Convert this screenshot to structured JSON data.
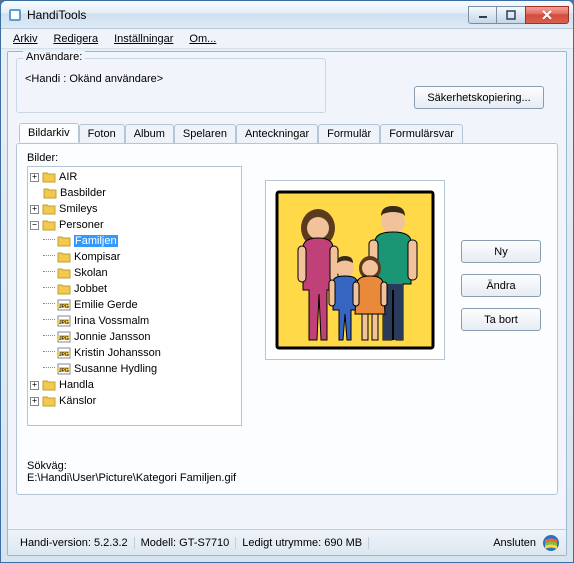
{
  "window": {
    "title": "HandiTools"
  },
  "menu": {
    "items": [
      "Arkiv",
      "Redigera",
      "Inställningar",
      "Om..."
    ]
  },
  "user_group": {
    "label": "Användare:",
    "text": "<Handi : Okänd användare>"
  },
  "buttons": {
    "backup": "Säkerhetskopiering...",
    "ny": "Ny",
    "andra": "Ändra",
    "ta_bort": "Ta bort"
  },
  "tabs": [
    "Bildarkiv",
    "Foton",
    "Album",
    "Spelaren",
    "Anteckningar",
    "Formulär",
    "Formulärsvar"
  ],
  "active_tab": 0,
  "tree_label": "Bilder:",
  "tree": {
    "root": [
      {
        "label": "AIR",
        "type": "folder",
        "expandable": true,
        "expanded": false
      },
      {
        "label": "Basbilder",
        "type": "folder",
        "expandable": false
      },
      {
        "label": "Smileys",
        "type": "folder",
        "expandable": true,
        "expanded": false
      },
      {
        "label": "Personer",
        "type": "folder",
        "expandable": true,
        "expanded": true,
        "children": [
          {
            "label": "Familjen",
            "type": "folder",
            "selected": true
          },
          {
            "label": "Kompisar",
            "type": "folder"
          },
          {
            "label": "Skolan",
            "type": "folder"
          },
          {
            "label": "Jobbet",
            "type": "folder"
          },
          {
            "label": "Emilie Gerde",
            "type": "jpg"
          },
          {
            "label": "Irina Vossmalm",
            "type": "jpg"
          },
          {
            "label": "Jonnie Jansson",
            "type": "jpg"
          },
          {
            "label": "Kristin Johansson",
            "type": "jpg"
          },
          {
            "label": "Susanne Hydling",
            "type": "jpg"
          }
        ]
      },
      {
        "label": "Handla",
        "type": "folder",
        "expandable": true,
        "expanded": false
      },
      {
        "label": "Känslor",
        "type": "folder",
        "expandable": true,
        "expanded": false
      }
    ]
  },
  "path": {
    "label": "Sökväg:",
    "value": "E:\\Handi\\User\\Picture\\Kategori Familjen.gif"
  },
  "status": {
    "version_label": "Handi-version:",
    "version": "5.2.3.2",
    "model_label": "Modell:",
    "model": "GT-S7710",
    "space_label": "Ledigt utrymme:",
    "space": "690 MB",
    "connected": "Ansluten"
  }
}
